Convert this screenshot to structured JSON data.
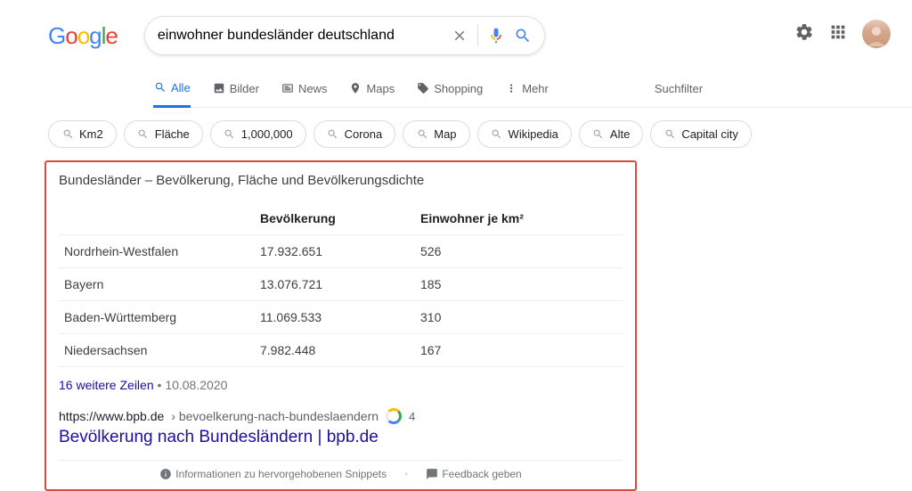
{
  "logo": {
    "g1": "G",
    "o1": "o",
    "o2": "o",
    "g2": "g",
    "l": "l",
    "e": "e"
  },
  "search": {
    "query": "einwohner bundesländer deutschland"
  },
  "tabs": {
    "all": "Alle",
    "images": "Bilder",
    "news": "News",
    "maps": "Maps",
    "shopping": "Shopping",
    "more": "Mehr",
    "filter": "Suchfilter"
  },
  "chips": [
    "Km2",
    "Fläche",
    "1,000,000",
    "Corona",
    "Map",
    "Wikipedia",
    "Alte",
    "Capital city"
  ],
  "snippet": {
    "heading": "Bundesländer – Bevölkerung, Fläche und Bevölkerungsdichte",
    "columns": [
      "",
      "Bevölkerung",
      "Einwohner je km²"
    ],
    "rows": [
      {
        "name": "Nordrhein-Westfalen",
        "pop": "17.932.651",
        "dens": "526"
      },
      {
        "name": "Bayern",
        "pop": "13.076.721",
        "dens": "185"
      },
      {
        "name": "Baden-Württemberg",
        "pop": "11.069.533",
        "dens": "310"
      },
      {
        "name": "Niedersachsen",
        "pop": "7.982.448",
        "dens": "167"
      }
    ],
    "more_rows": "16 weitere Zeilen",
    "date": "10.08.2020",
    "url_host": "https://www.bpb.de",
    "url_path": " › bevoelkerung-nach-bundeslaendern",
    "rank": "4",
    "title": "Bevölkerung nach Bundesländern | bpb.de",
    "info_label": "Informationen zu hervorgehobenen Snippets",
    "feedback_label": "Feedback geben"
  }
}
